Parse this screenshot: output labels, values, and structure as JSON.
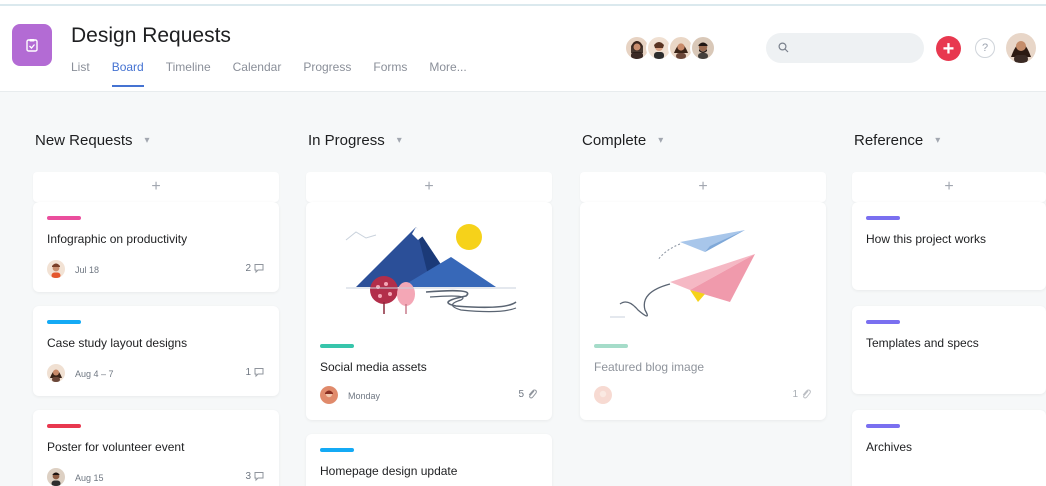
{
  "project": {
    "title": "Design Requests",
    "icon": "clipboard-icon",
    "color": "#b36bd4"
  },
  "tabs": [
    {
      "label": "List",
      "active": false
    },
    {
      "label": "Board",
      "active": true
    },
    {
      "label": "Timeline",
      "active": false
    },
    {
      "label": "Calendar",
      "active": false
    },
    {
      "label": "Progress",
      "active": false
    },
    {
      "label": "Forms",
      "active": false
    },
    {
      "label": "More...",
      "active": false
    }
  ],
  "header": {
    "search_placeholder": "",
    "add_label": "+",
    "help_label": "?"
  },
  "columns": [
    {
      "title": "New Requests",
      "add_label": "+",
      "cards": [
        {
          "title": "Infographic on productivity",
          "stripe": "#ea4e9d",
          "date": "Jul 18",
          "count": "2",
          "count_icon": "comment-icon"
        },
        {
          "title": "Case study layout designs",
          "stripe": "#14aaf5",
          "date": "Aug 4 – 7",
          "count": "1",
          "count_icon": "comment-icon"
        },
        {
          "title": "Poster for volunteer event",
          "stripe": "#e8384f",
          "date": "Aug 15",
          "count": "3",
          "count_icon": "comment-icon"
        }
      ]
    },
    {
      "title": "In Progress",
      "add_label": "+",
      "cards": [
        {
          "title": "Social media assets",
          "stripe": "#37c5ab",
          "date": "Monday",
          "count": "5",
          "count_icon": "paperclip-icon",
          "image": "mountains-illustration"
        },
        {
          "title": "Homepage design update",
          "stripe": "#14aaf5"
        }
      ]
    },
    {
      "title": "Complete",
      "add_label": "+",
      "cards": [
        {
          "title": "Featured blog image",
          "stripe": "#a5dcc9",
          "count": "1",
          "count_icon": "paperclip-icon",
          "image": "paper-planes-illustration",
          "completed": true
        }
      ]
    },
    {
      "title": "Reference",
      "add_label": "+",
      "cards": [
        {
          "title": "How this project works",
          "stripe": "#7a6ff0"
        },
        {
          "title": "Templates and specs",
          "stripe": "#7a6ff0"
        },
        {
          "title": "Archives",
          "stripe": "#7a6ff0"
        }
      ]
    }
  ]
}
